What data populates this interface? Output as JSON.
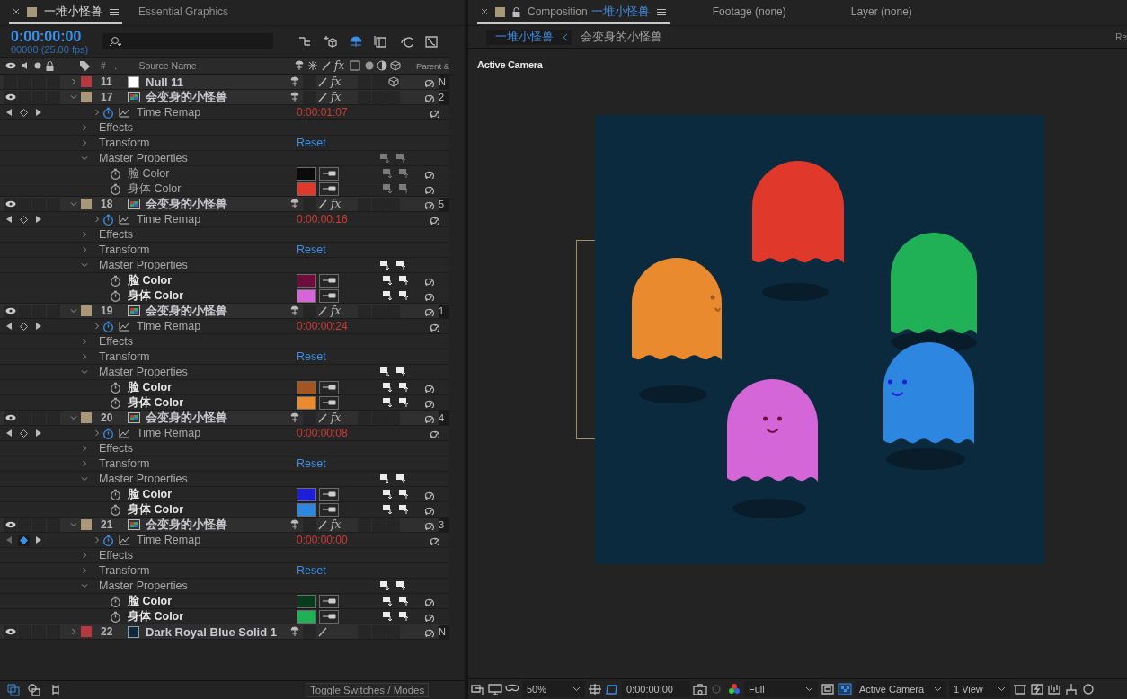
{
  "panel_tabs": [
    {
      "label": "一堆小怪兽",
      "selected": true,
      "kind": "timeline"
    },
    {
      "label": "Essential Graphics",
      "selected": false,
      "kind": "plain"
    }
  ],
  "timecode": "0:00:00:00",
  "frame_info": "00000 (25.00 fps)",
  "columns": {
    "number": "#",
    "dot": ".",
    "source_name": "Source Name",
    "effects": "fx",
    "parent": "Parent &"
  },
  "layers": [
    {
      "number": "11",
      "name": "Null 11",
      "kind": "null",
      "color": "#b5393c",
      "visible": false,
      "expanded": false,
      "fx": "fx",
      "three_d": true,
      "parent": "N"
    },
    {
      "number": "17",
      "name": "会变身的小怪兽",
      "kind": "comp",
      "color": "#a89878",
      "visible": true,
      "expanded": true,
      "fx": "fx",
      "three_d": false,
      "parent": "2",
      "time_remap": {
        "label": "Time Remap",
        "value": "0:00:01:07",
        "at_keyframe": false
      },
      "groups": [
        {
          "label": "Effects",
          "expanded": false
        },
        {
          "label": "Transform",
          "expanded": false,
          "action": "Reset"
        },
        {
          "label": "Master Properties",
          "expanded": true
        }
      ],
      "master": [
        {
          "label": "脸 Color",
          "color": "#0b0b0b",
          "modified": false
        },
        {
          "label": "身体 Color",
          "color": "#e0392b",
          "modified": false
        }
      ]
    },
    {
      "number": "18",
      "name": "会变身的小怪兽",
      "kind": "comp",
      "color": "#a89878",
      "visible": true,
      "expanded": true,
      "fx": "fx",
      "three_d": false,
      "parent": "5",
      "time_remap": {
        "label": "Time Remap",
        "value": "0:00:00:16",
        "at_keyframe": false
      },
      "groups": [
        {
          "label": "Effects",
          "expanded": false
        },
        {
          "label": "Transform",
          "expanded": false,
          "action": "Reset"
        },
        {
          "label": "Master Properties",
          "expanded": true
        }
      ],
      "master": [
        {
          "label": "脸 Color",
          "color": "#6e0d3c",
          "modified": true
        },
        {
          "label": "身体 Color",
          "color": "#d466d8",
          "modified": true
        }
      ]
    },
    {
      "number": "19",
      "name": "会变身的小怪兽",
      "kind": "comp",
      "color": "#a89878",
      "visible": true,
      "expanded": true,
      "fx": "fx",
      "three_d": false,
      "parent": "1",
      "time_remap": {
        "label": "Time Remap",
        "value": "0:00:00:24",
        "at_keyframe": false
      },
      "groups": [
        {
          "label": "Effects",
          "expanded": false
        },
        {
          "label": "Transform",
          "expanded": false,
          "action": "Reset"
        },
        {
          "label": "Master Properties",
          "expanded": true
        }
      ],
      "master": [
        {
          "label": "脸 Color",
          "color": "#a4561e",
          "modified": true
        },
        {
          "label": "身体 Color",
          "color": "#e98a2e",
          "modified": true
        }
      ]
    },
    {
      "number": "20",
      "name": "会变身的小怪兽",
      "kind": "comp",
      "color": "#a89878",
      "visible": true,
      "expanded": true,
      "fx": "fx",
      "three_d": false,
      "parent": "4",
      "time_remap": {
        "label": "Time Remap",
        "value": "0:00:00:08",
        "at_keyframe": false
      },
      "groups": [
        {
          "label": "Effects",
          "expanded": false
        },
        {
          "label": "Transform",
          "expanded": false,
          "action": "Reset"
        },
        {
          "label": "Master Properties",
          "expanded": true
        }
      ],
      "master": [
        {
          "label": "脸 Color",
          "color": "#1d1ed6",
          "modified": true
        },
        {
          "label": "身体 Color",
          "color": "#2d86e0",
          "modified": true
        }
      ]
    },
    {
      "number": "21",
      "name": "会变身的小怪兽",
      "kind": "comp",
      "color": "#a89878",
      "visible": true,
      "expanded": true,
      "fx": "fx",
      "three_d": false,
      "parent": "3",
      "time_remap": {
        "label": "Time Remap",
        "value": "0:00:00:00",
        "at_keyframe": true
      },
      "groups": [
        {
          "label": "Effects",
          "expanded": false
        },
        {
          "label": "Transform",
          "expanded": false,
          "action": "Reset"
        },
        {
          "label": "Master Properties",
          "expanded": true
        }
      ],
      "master": [
        {
          "label": "脸 Color",
          "color": "#073b1c",
          "modified": true
        },
        {
          "label": "身体 Color",
          "color": "#20b156",
          "modified": true
        }
      ]
    },
    {
      "number": "22",
      "name": "Dark Royal Blue Solid 1",
      "kind": "solid",
      "color": "#b5393c",
      "visible": true,
      "expanded": false,
      "three_d": false,
      "parent": "N"
    }
  ],
  "toggle_button": "Toggle Switches / Modes",
  "viewer": {
    "tabs": [
      {
        "label": "Composition",
        "comp": "一堆小怪兽",
        "selected": true
      },
      {
        "label": "Footage (none)",
        "selected": false
      },
      {
        "label": "Layer (none)",
        "selected": false
      }
    ],
    "breadcrumbs": [
      {
        "label": "一堆小怪兽",
        "selected": true
      },
      {
        "label": "会变身的小怪兽",
        "selected": false
      }
    ],
    "cut_text": "Re",
    "camera_label": "Active Camera",
    "toolbar": {
      "zoom": "50%",
      "time": "0:00:00:00",
      "resolution": "Full",
      "camera": "Active Camera",
      "views": "1 View"
    }
  }
}
